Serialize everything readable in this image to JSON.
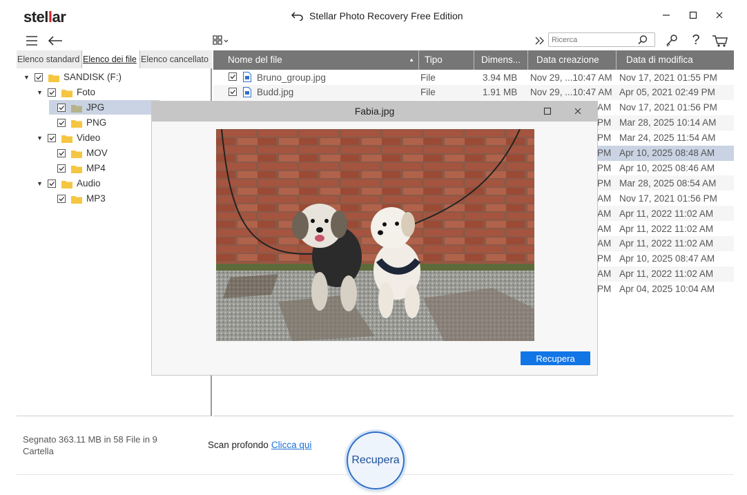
{
  "app": {
    "logo_prefix": "stel",
    "logo_mid": "l",
    "logo_suffix": "ar",
    "title": "Stellar Photo Recovery Free Edition"
  },
  "toolbar": {
    "search_placeholder": "Ricerca"
  },
  "tabs": [
    {
      "label": "Elenco standard",
      "active": false
    },
    {
      "label": "Elenco dei file",
      "active": true
    },
    {
      "label": "Elenco cancellato",
      "active": false
    }
  ],
  "tree": [
    {
      "label": "SANDISK (F:)",
      "level": 0,
      "expanded": true,
      "selected": false,
      "icon": "folder-icon"
    },
    {
      "label": "Foto",
      "level": 1,
      "expanded": true,
      "selected": false,
      "icon": "folder-icon"
    },
    {
      "label": "JPG",
      "level": 2,
      "expanded": null,
      "selected": true,
      "icon": "folder-icon"
    },
    {
      "label": "PNG",
      "level": 2,
      "expanded": null,
      "selected": false,
      "icon": "folder-icon"
    },
    {
      "label": "Video",
      "level": 1,
      "expanded": true,
      "selected": false,
      "icon": "folder-icon"
    },
    {
      "label": "MOV",
      "level": 2,
      "expanded": null,
      "selected": false,
      "icon": "folder-icon"
    },
    {
      "label": "MP4",
      "level": 2,
      "expanded": null,
      "selected": false,
      "icon": "folder-icon"
    },
    {
      "label": "Audio",
      "level": 1,
      "expanded": true,
      "selected": false,
      "icon": "folder-icon"
    },
    {
      "label": "MP3",
      "level": 2,
      "expanded": null,
      "selected": false,
      "icon": "folder-icon"
    }
  ],
  "columns": [
    "Nome del file",
    "Tipo",
    "Dimens...",
    "Data creazione",
    "Data di modifica"
  ],
  "files": [
    {
      "name": "Bruno_group.jpg",
      "type": "File",
      "size": "3.94 MB",
      "created": "Nov 29, ...10:47 AM",
      "modified": "Nov 17, 2021 01:55 PM",
      "selected": false
    },
    {
      "name": "Budd.jpg",
      "type": "File",
      "size": "1.91 MB",
      "created": "Nov 29, ...10:47 AM",
      "modified": "Apr 05, 2021 02:49 PM",
      "selected": false
    },
    {
      "name": "",
      "type": "",
      "size": "",
      "created": "AM",
      "modified": "Nov 17, 2021 01:56 PM",
      "selected": false
    },
    {
      "name": "",
      "type": "",
      "size": "",
      "created": "PM",
      "modified": "Mar 28, 2025 10:14 AM",
      "selected": false
    },
    {
      "name": "",
      "type": "",
      "size": "",
      "created": "PM",
      "modified": "Mar 24, 2025 11:54 AM",
      "selected": false
    },
    {
      "name": "",
      "type": "",
      "size": "",
      "created": "PM",
      "modified": "Apr 10, 2025 08:48 AM",
      "selected": true
    },
    {
      "name": "",
      "type": "",
      "size": "",
      "created": "PM",
      "modified": "Apr 10, 2025 08:46 AM",
      "selected": false
    },
    {
      "name": "",
      "type": "",
      "size": "",
      "created": "PM",
      "modified": "Mar 28, 2025 08:54 AM",
      "selected": false
    },
    {
      "name": "",
      "type": "",
      "size": "",
      "created": "AM",
      "modified": "Nov 17, 2021 01:56 PM",
      "selected": false
    },
    {
      "name": "",
      "type": "",
      "size": "",
      "created": "AM",
      "modified": "Apr 11, 2022 11:02 AM",
      "selected": false
    },
    {
      "name": "",
      "type": "",
      "size": "",
      "created": "AM",
      "modified": "Apr 11, 2022 11:02 AM",
      "selected": false
    },
    {
      "name": "",
      "type": "",
      "size": "",
      "created": "AM",
      "modified": "Apr 11, 2022 11:02 AM",
      "selected": false
    },
    {
      "name": "",
      "type": "",
      "size": "",
      "created": "PM",
      "modified": "Apr 10, 2025 08:47 AM",
      "selected": false
    },
    {
      "name": "",
      "type": "",
      "size": "",
      "created": "AM",
      "modified": "Apr 11, 2022 11:02 AM",
      "selected": false
    },
    {
      "name": "",
      "type": "",
      "size": "",
      "created": "PM",
      "modified": "Apr 04, 2025 10:04 AM",
      "selected": false
    }
  ],
  "preview": {
    "title": "Fabia.jpg",
    "button": "Recupera"
  },
  "footer": {
    "status": "Segnato 363.11 MB in 58 File in 9 Cartella",
    "scan_label": "Scan profondo",
    "scan_link": "Clicca qui",
    "recover_button": "Recupera"
  },
  "colors": {
    "accent": "#1275e6",
    "header_bg": "#767676",
    "selected_row": "#c9d3e3",
    "logo_red": "#d62027",
    "folder": "#f5c542"
  }
}
